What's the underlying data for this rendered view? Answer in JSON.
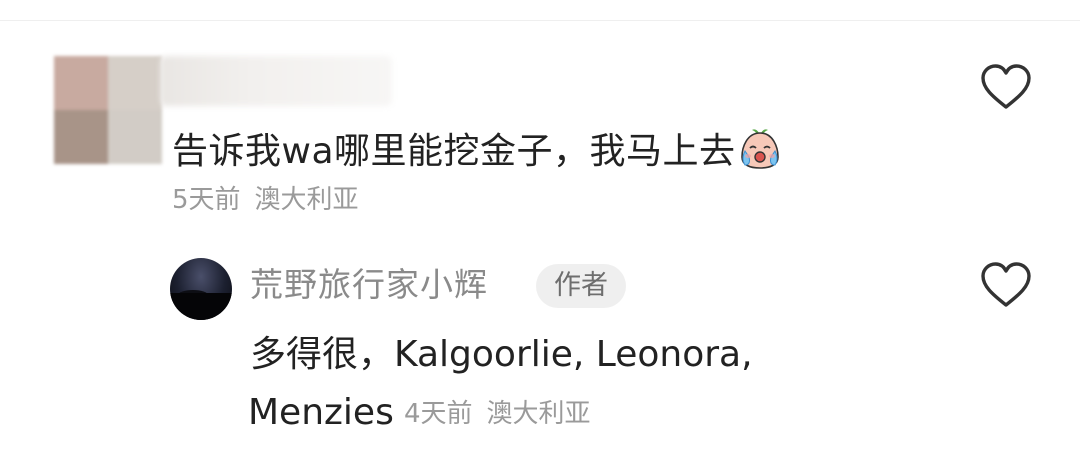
{
  "comment": {
    "text": "告诉我wa哪里能挖金子，我马上去",
    "emoji_icon": "crying-face-emoji",
    "time": "5天前",
    "location": "澳大利亚",
    "like_icon": "heart-outline-icon"
  },
  "reply": {
    "username": "荒野旅行家小辉",
    "author_badge": "作者",
    "text_line1": "多得很，Kalgoorlie, Leonora,",
    "text_line2": "Menzies",
    "time": "4天前",
    "location": "澳大利亚",
    "like_icon": "heart-outline-icon"
  },
  "colors": {
    "primary_text": "#222222",
    "secondary_text": "#9a9a9a",
    "username_text": "#8a8a8a",
    "badge_bg": "#efefef",
    "heart_stroke": "#333333"
  }
}
